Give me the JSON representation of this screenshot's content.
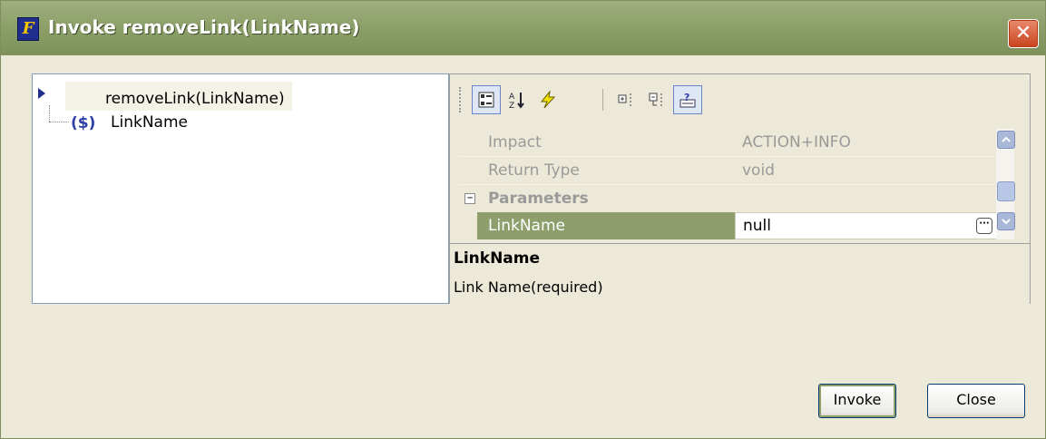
{
  "window": {
    "title": "Invoke removeLink(LinkName)",
    "app_icon_letter": "F",
    "close_glyph": "✕"
  },
  "tree": {
    "root_label": "removeLink(LinkName)",
    "child_icon_text": "($)",
    "child_label": "LinkName"
  },
  "toolbar": {
    "buttons": [
      {
        "name": "categorized-view-icon",
        "active": true
      },
      {
        "name": "sort-alphabetical-icon",
        "active": false
      },
      {
        "name": "events-lightning-icon",
        "active": false
      },
      {
        "name": "expand-all-icon",
        "active": false
      },
      {
        "name": "collapse-all-icon",
        "active": false
      },
      {
        "name": "show-description-icon",
        "active": true
      }
    ]
  },
  "properties": {
    "rows": [
      {
        "key": "Impact",
        "value": "ACTION+INFO"
      },
      {
        "key": "Return Type",
        "value": "void"
      }
    ],
    "category": {
      "label": "Parameters",
      "toggle": "−"
    },
    "selected_row": {
      "key": "LinkName",
      "value": "null",
      "button_glyph": "···"
    }
  },
  "description": {
    "title": "LinkName",
    "text": "Link Name(required)"
  },
  "buttons": {
    "invoke": "Invoke",
    "close": "Close"
  },
  "colors": {
    "titlebar": "#8EA06A",
    "selection": "#8E9E6C",
    "accent": "#2E3FA8"
  }
}
